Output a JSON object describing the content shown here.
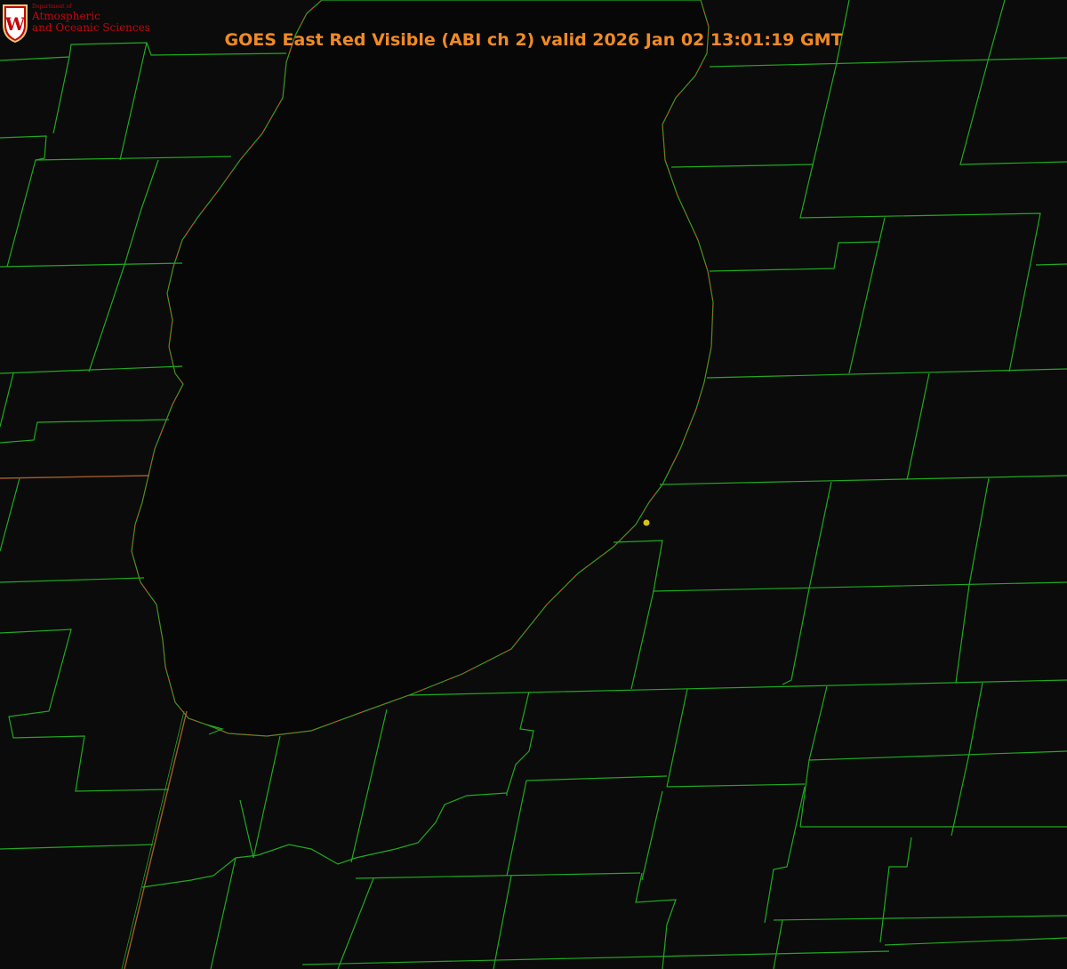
{
  "title": "GOES East Red Visible (ABI ch 2) valid 2026 Jan 02 13:01:19 GMT",
  "logo": {
    "dept_label": "Department of",
    "line1": "Atmospheric",
    "line2": "and Oceanic Sciences",
    "crest_letter": "W"
  },
  "colors": {
    "background": "#0b0b0b",
    "lake": "#070707",
    "county_lines": "#1faa1f",
    "state_line": "#a05a2a",
    "coastline": "#ff2a2a",
    "title": "#f08a24",
    "marker": "#d8c21a",
    "logo_red": "#c5050c",
    "logo_gold": "#e8c870"
  },
  "icons": {
    "crest": "uw-crest-icon",
    "marker": "location-marker-icon"
  }
}
